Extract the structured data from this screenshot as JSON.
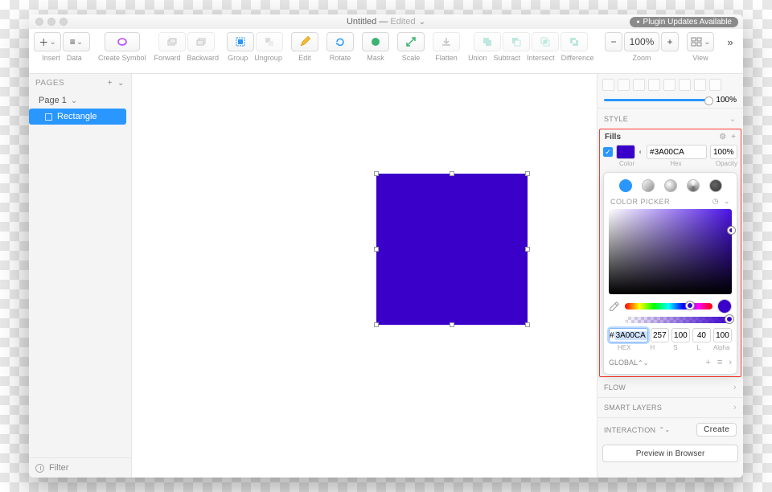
{
  "title": {
    "name": "Untitled",
    "state": "Edited"
  },
  "plugin_banner": "Plugin Updates Available",
  "toolbar": {
    "insert": "Insert",
    "data": "Data",
    "create_symbol": "Create Symbol",
    "forward": "Forward",
    "backward": "Backward",
    "group": "Group",
    "ungroup": "Ungroup",
    "edit": "Edit",
    "rotate": "Rotate",
    "mask": "Mask",
    "scale": "Scale",
    "flatten": "Flatten",
    "union": "Union",
    "subtract": "Subtract",
    "intersect": "Intersect",
    "difference": "Difference",
    "zoom_value": "100%",
    "zoom": "Zoom",
    "view": "View"
  },
  "sidebar": {
    "pages_label": "PAGES",
    "page_name": "Page 1",
    "layer_name": "Rectangle",
    "filter": "Filter"
  },
  "inspector": {
    "opacity_value": "100%",
    "style": "STYLE",
    "fills": {
      "title": "Fills",
      "hex": "3A00CA",
      "opacity": "100%",
      "color_lbl": "Color",
      "hex_lbl": "Hex",
      "opacity_lbl": "Opacity"
    },
    "picker": {
      "title": "COLOR PICKER",
      "hex": "3A00CA",
      "h": "257",
      "s": "100",
      "l": "40",
      "a": "100",
      "hex_lbl": "HEX",
      "h_lbl": "H",
      "s_lbl": "S",
      "l_lbl": "L",
      "a_lbl": "Alpha",
      "global": "GLOBAL"
    },
    "flow": "FLOW",
    "smart": "SMART LAYERS",
    "interaction": "INTERACTION",
    "create": "Create",
    "preview": "Preview in Browser"
  },
  "colors": {
    "fill": "#3A00CA",
    "accent": "#2a97ff"
  }
}
